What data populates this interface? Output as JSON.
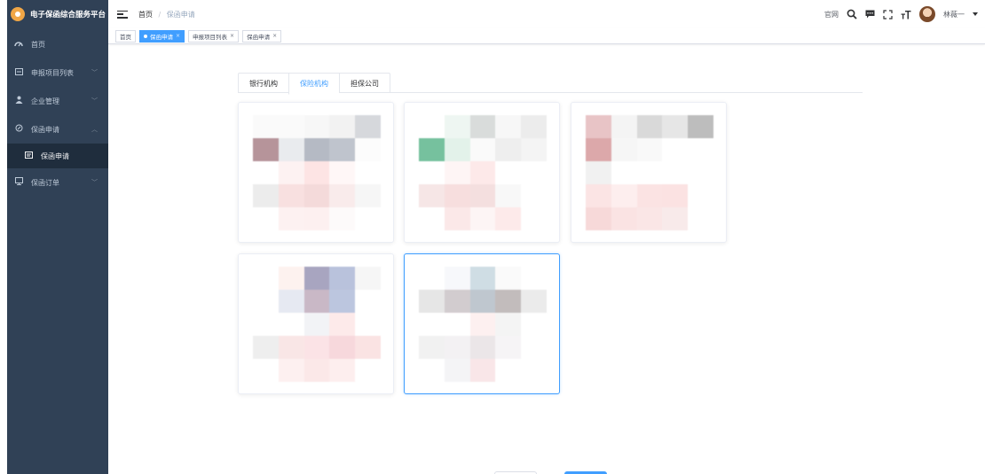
{
  "app": {
    "title": "电子保函综合服务平台"
  },
  "sidebar": {
    "items": [
      {
        "label": "首页",
        "icon": "dashboard-icon"
      },
      {
        "label": "申报项目列表",
        "icon": "list-icon"
      },
      {
        "label": "企业管理",
        "icon": "user-icon"
      },
      {
        "label": "保函申请",
        "icon": "guarantee-icon"
      },
      {
        "label": "保函申请",
        "icon": "form-icon"
      },
      {
        "label": "保函订单",
        "icon": "order-icon"
      }
    ]
  },
  "breadcrumb": {
    "home": "首页",
    "current": "保函申请",
    "separator": "/"
  },
  "header": {
    "site_link": "官网",
    "user_name": "林薇一"
  },
  "tags": [
    {
      "label": "首页"
    },
    {
      "label": "保函申请"
    },
    {
      "label": "申报项目列表"
    },
    {
      "label": "保函申请"
    }
  ],
  "tabs": [
    {
      "label": "银行机构"
    },
    {
      "label": "保险机构"
    },
    {
      "label": "担保公司"
    }
  ],
  "colors": {
    "accent": "#409eff",
    "sidebar_bg": "#304156",
    "sidebar_active_bg": "#1f2d3d",
    "logo": "#f0a646"
  }
}
